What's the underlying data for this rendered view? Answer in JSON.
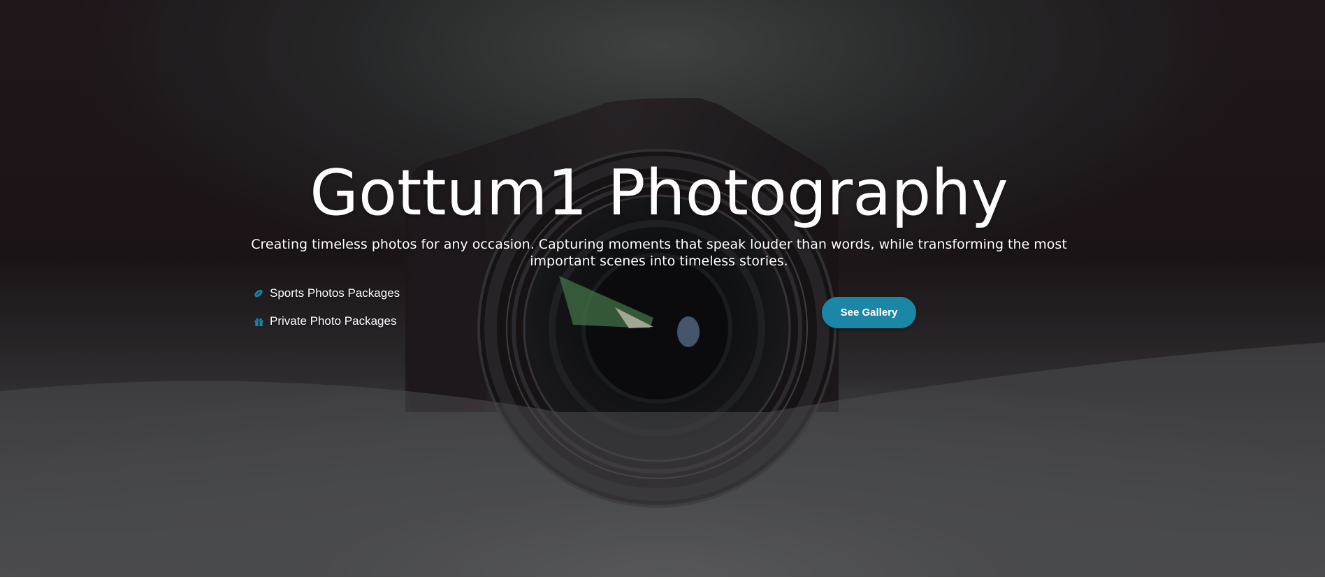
{
  "hero": {
    "title": "Gottum1 Photography",
    "subtitle": "Creating timeless photos for any occasion. Capturing moments that speak louder than words, while transforming the most important scenes into timeless stories."
  },
  "packages": [
    {
      "label": "Sports Photos Packages",
      "icon": "football-icon"
    },
    {
      "label": "Private Photo Packages",
      "icon": "gift-icon"
    }
  ],
  "gallery_button": {
    "label": "See Gallery"
  },
  "colors": {
    "accent": "#1b86a5",
    "text": "#ffffff",
    "background": "#1f181b"
  }
}
